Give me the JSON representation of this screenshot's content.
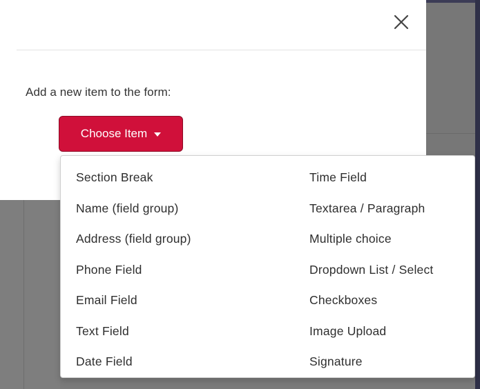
{
  "modal": {
    "close_label": "×",
    "prompt": "Add a new item to the form:",
    "choose_button": "Choose Item"
  },
  "dropdown": {
    "left_column": [
      "Section Break",
      "Name (field group)",
      "Address (field group)",
      "Phone Field",
      "Email Field",
      "Text Field",
      "Date Field"
    ],
    "right_column": [
      "Time Field",
      "Textarea / Paragraph",
      "Multiple choice",
      "Dropdown List / Select",
      "Checkboxes",
      "Image Upload",
      "Signature"
    ]
  },
  "icons": {
    "close": "close-icon",
    "caret": "caret-down-icon"
  },
  "colors": {
    "accent_button": "#d0103a",
    "overlay": "#7a7a7a",
    "modal_bg": "#ffffff"
  }
}
